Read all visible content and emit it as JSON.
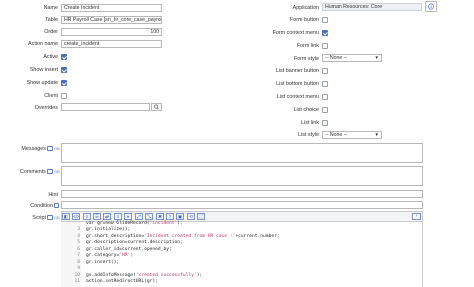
{
  "left_fields": {
    "name_label": "Name",
    "name_value": "Create Incident",
    "table_label": "Table",
    "table_value": "HR Payroll Case [sn_hr_core_case_payroll]",
    "order_label": "Order",
    "order_value": "100",
    "action_name_label": "Action name",
    "action_name_value": "create_incident",
    "active_label": "Active",
    "show_insert_label": "Show insert",
    "show_update_label": "Show update",
    "client_label": "Client",
    "overrides_label": "Overrides"
  },
  "right_fields": {
    "application_label": "Application",
    "application_value": "Human Resources: Core",
    "form_button_label": "Form button",
    "form_context_menu_label": "Form context menu",
    "form_link_label": "Form link",
    "form_style_label": "Form style",
    "form_style_value": "-- None --",
    "list_banner_button_label": "List banner button",
    "list_bottom_button_label": "List bottom button",
    "list_context_menu_label": "List context menu",
    "list_choice_label": "List choice",
    "list_link_label": "List link",
    "list_style_label": "List style",
    "list_style_value": "-- None --"
  },
  "checkbox_states": {
    "active": true,
    "show_insert": true,
    "show_update": true,
    "client": false,
    "form_button": false,
    "form_context_menu": true,
    "form_link": false,
    "list_banner_button": false,
    "list_bottom_button": false,
    "list_context_menu": false,
    "list_choice": false,
    "list_link": false
  },
  "bottom_fields": {
    "messages_label": "Messages",
    "comments_label": "Comments",
    "hint_label": "Hint",
    "condition_label": "Condition",
    "script_label": "Script",
    "lang_icon_text": "GB"
  },
  "script_lines": [
    {
      "num": "",
      "code": "var gr=new GlideRecord('incident');"
    },
    {
      "num": "",
      "code": "gr.initialize();"
    },
    {
      "num": "",
      "code": "gr.short_description='Incident created from HR case :'+current.number;"
    },
    {
      "num": "",
      "code": "gr.description=current.description;"
    },
    {
      "num": "",
      "code": "gr.caller_id=current.opened_by;"
    },
    {
      "num": "",
      "code": "gr.category='HR';"
    },
    {
      "num": "",
      "code": "gr.insert();"
    },
    {
      "num": "",
      "code": ""
    },
    {
      "num": "",
      "code": "gs.addInfoMessage('created successfully');"
    },
    {
      "num": "11",
      "code": "action.setRedirectURL(gr);"
    }
  ],
  "visible_line_numbers": [
    "3",
    "4",
    "5",
    "6",
    "7",
    "8",
    "9",
    "10",
    "11"
  ],
  "colors": {
    "checked": "#4c6fbf",
    "string": "#b8336a"
  }
}
